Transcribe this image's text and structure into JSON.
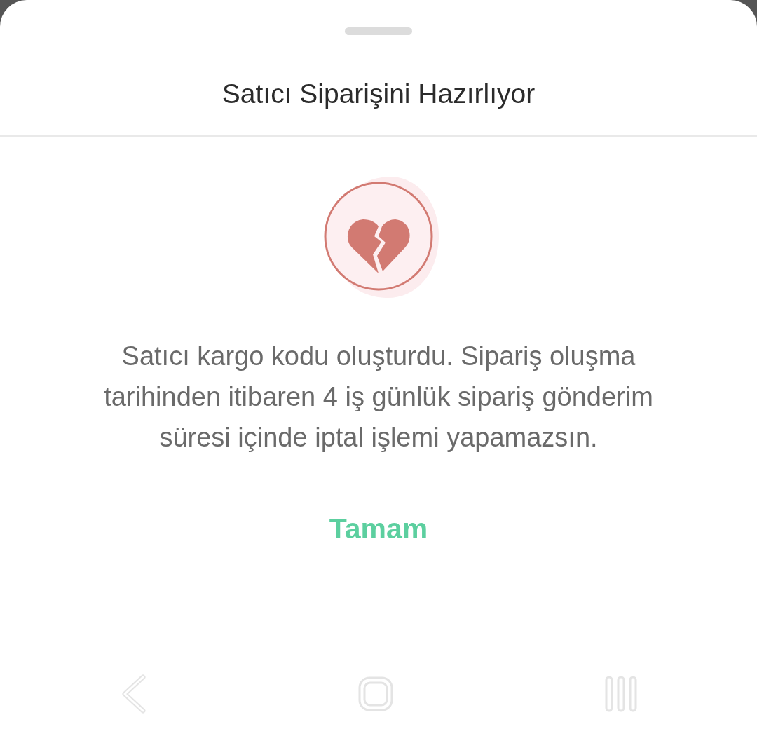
{
  "sheet": {
    "title": "Satıcı Siparişini Hazırlıyor",
    "message": "Satıcı kargo kodu oluşturdu. Sipariş oluşma tarihinden itibaren 4 iş günlük sipariş gönderim süresi içinde iptal işlemi yapamazsın.",
    "button": "Tamam"
  }
}
